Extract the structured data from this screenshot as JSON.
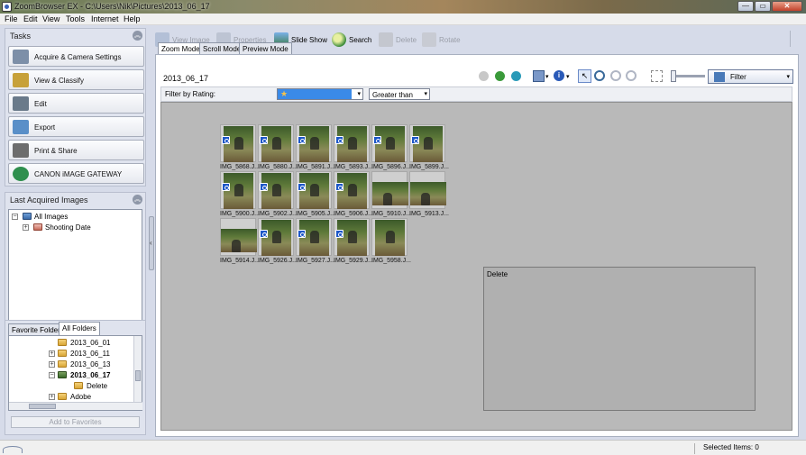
{
  "window": {
    "title": "ZoomBrowser EX  -  C:\\Users\\Nik\\Pictures\\2013_06_17",
    "controls": [
      "—",
      "▭",
      "✕"
    ]
  },
  "menu": [
    "File",
    "Edit",
    "View",
    "Tools",
    "Internet",
    "Help"
  ],
  "tasks": {
    "header": "Tasks",
    "items": [
      {
        "label": "Acquire & Camera Settings",
        "icon": "camera-icon",
        "color": "#7d8fa8"
      },
      {
        "label": "View & Classify",
        "icon": "view-classify-icon",
        "color": "#c7a13a"
      },
      {
        "label": "Edit",
        "icon": "edit-icon",
        "color": "#6a7a8a"
      },
      {
        "label": "Export",
        "icon": "export-icon",
        "color": "#5a8fc8"
      },
      {
        "label": "Print & Share",
        "icon": "printer-icon",
        "color": "#6d6d6d"
      },
      {
        "label": "CANON iMAGE GATEWAY",
        "icon": "globe-icon",
        "color": "#2f8f4e"
      }
    ]
  },
  "last_acquired": {
    "header": "Last Acquired Images",
    "tree": [
      "All Images",
      "Shooting Date"
    ]
  },
  "folders": {
    "tabs": [
      "Favorite Folders",
      "All Folders"
    ],
    "active_tab": "All Folders",
    "items": [
      "2013_06_01",
      "2013_06_11",
      "2013_06_13",
      "2013_06_17",
      "Delete",
      "Adobe"
    ],
    "selected": "2013_06_17",
    "add_button": "Add to Favorites"
  },
  "toolbar": {
    "buttons": [
      {
        "label": "View Image",
        "enabled": false,
        "icon": "view-image-icon"
      },
      {
        "label": "Properties",
        "enabled": false,
        "icon": "properties-icon"
      },
      {
        "label": "Slide Show",
        "enabled": true,
        "icon": "slideshow-icon"
      },
      {
        "label": "Search",
        "enabled": true,
        "icon": "search-icon"
      },
      {
        "label": "Delete",
        "enabled": false,
        "icon": "trash-icon"
      },
      {
        "label": "Rotate",
        "enabled": false,
        "icon": "rotate-icon"
      }
    ]
  },
  "view_modes": [
    "Zoom Mode",
    "Scroll Mode",
    "Preview Mode"
  ],
  "active_mode": "Zoom Mode",
  "current_folder": "2013_06_17",
  "filter": {
    "label": "Filter by Rating:",
    "rating_value": "★",
    "comparison": "Greater than",
    "dropdown": "Filter"
  },
  "thumbnails": [
    {
      "label": "IMG_5868.J...",
      "wide": false,
      "mark": true
    },
    {
      "label": "IMG_5880.J...",
      "wide": false,
      "mark": true
    },
    {
      "label": "IMG_5891.J...",
      "wide": false,
      "mark": true
    },
    {
      "label": "IMG_5893.J...",
      "wide": false,
      "mark": true
    },
    {
      "label": "IMG_5896.J...",
      "wide": false,
      "mark": true
    },
    {
      "label": "IMG_5899.J...",
      "wide": false,
      "mark": true
    },
    {
      "label": "IMG_5900.J...",
      "wide": false,
      "mark": true
    },
    {
      "label": "IMG_5902.J...",
      "wide": false,
      "mark": true
    },
    {
      "label": "IMG_5905.J...",
      "wide": false,
      "mark": true
    },
    {
      "label": "IMG_5906.J...",
      "wide": false,
      "mark": true
    },
    {
      "label": "IMG_5910.J...",
      "wide": true,
      "mark": false
    },
    {
      "label": "IMG_5913.J...",
      "wide": true,
      "mark": false
    },
    {
      "label": "IMG_5914.J...",
      "wide": true,
      "mark": false
    },
    {
      "label": "IMG_5926.J...",
      "wide": false,
      "mark": true
    },
    {
      "label": "IMG_5927.J...",
      "wide": false,
      "mark": true
    },
    {
      "label": "IMG_5929.J...",
      "wide": false,
      "mark": true
    },
    {
      "label": "IMG_5958.J...",
      "wide": false,
      "mark": false
    }
  ],
  "subfolder_box": {
    "label": "Delete"
  },
  "status": {
    "selected_items": "Selected Items: 0"
  }
}
